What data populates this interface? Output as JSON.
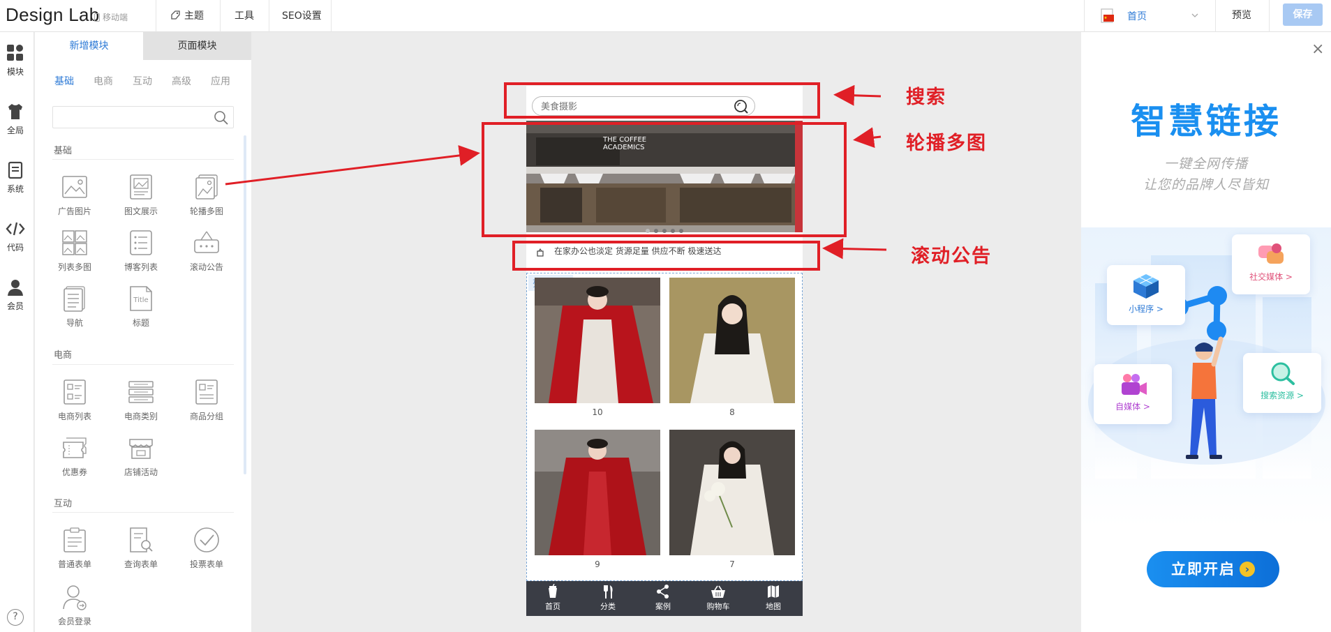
{
  "app": {
    "logo": "Design Lab",
    "device_label": "移动端"
  },
  "topnav": [
    {
      "label": "主题",
      "icon": "theme-icon"
    },
    {
      "label": "工具",
      "icon": ""
    },
    {
      "label": "SEO设置",
      "icon": ""
    }
  ],
  "header_right": {
    "page_select": "首页",
    "preview_label": "预览",
    "save_label": "保存",
    "flag_icon": "china-flag-icon"
  },
  "rail": [
    {
      "label": "模块",
      "icon": "modules-icon"
    },
    {
      "label": "全局",
      "icon": "shirt-icon"
    },
    {
      "label": "系统",
      "icon": "document-icon"
    },
    {
      "label": "代码",
      "icon": "code-icon"
    },
    {
      "label": "会员",
      "icon": "user-icon"
    }
  ],
  "panel": {
    "tabs": [
      "新增模块",
      "页面模块"
    ],
    "subtabs": [
      "基础",
      "电商",
      "互动",
      "高级",
      "应用"
    ],
    "search_placeholder": "",
    "sections": [
      {
        "title": "基础",
        "items": [
          "广告图片",
          "图文展示",
          "轮播多图",
          "列表多图",
          "博客列表",
          "滚动公告",
          "导航",
          "标题"
        ]
      },
      {
        "title": "电商",
        "items": [
          "电商列表",
          "电商类别",
          "商品分组",
          "优惠券",
          "店铺活动"
        ]
      },
      {
        "title": "互动",
        "items": [
          "普通表单",
          "查询表单",
          "投票表单",
          "会员登录"
        ]
      }
    ],
    "title_icon_text": "Title"
  },
  "phone": {
    "search_placeholder": "美食摄影",
    "banner_sign": "THE COFFEE ACADEMICS",
    "notice_text": "在家办公也淡定 货源足量 供应不断 极速送达",
    "list_tag": "列表多图",
    "list_items": [
      {
        "caption": "10",
        "tone": "red"
      },
      {
        "caption": "8",
        "tone": "white"
      },
      {
        "caption": "9",
        "tone": "red"
      },
      {
        "caption": "7",
        "tone": "white"
      }
    ],
    "tabbar": [
      {
        "label": "首页",
        "icon": "cup-icon"
      },
      {
        "label": "分类",
        "icon": "utensils-icon"
      },
      {
        "label": "案例",
        "icon": "share-icon"
      },
      {
        "label": "购物车",
        "icon": "basket-icon"
      },
      {
        "label": "地图",
        "icon": "map-icon"
      }
    ]
  },
  "annotations": {
    "search": "搜索",
    "carousel": "轮播多图",
    "notice": "滚动公告",
    "color": "#e01f26"
  },
  "promo": {
    "title": "智慧链接",
    "subtitle1": "一键全网传播",
    "subtitle2": "让您的品牌人尽皆知",
    "cards": [
      {
        "label": "社交媒体 >",
        "color": "#e0527a"
      },
      {
        "label": "小程序 >",
        "color": "#2d7ad6"
      },
      {
        "label": "自媒体 >",
        "color": "#b043d1"
      },
      {
        "label": "搜索资源 >",
        "color": "#2dbfa0"
      }
    ],
    "cta": "立即开启",
    "cta_arrow": "›"
  },
  "colors": {
    "accent": "#2d7ad6",
    "save_bg": "#a8c9f3",
    "tabbar_bg": "#3a3d45"
  }
}
